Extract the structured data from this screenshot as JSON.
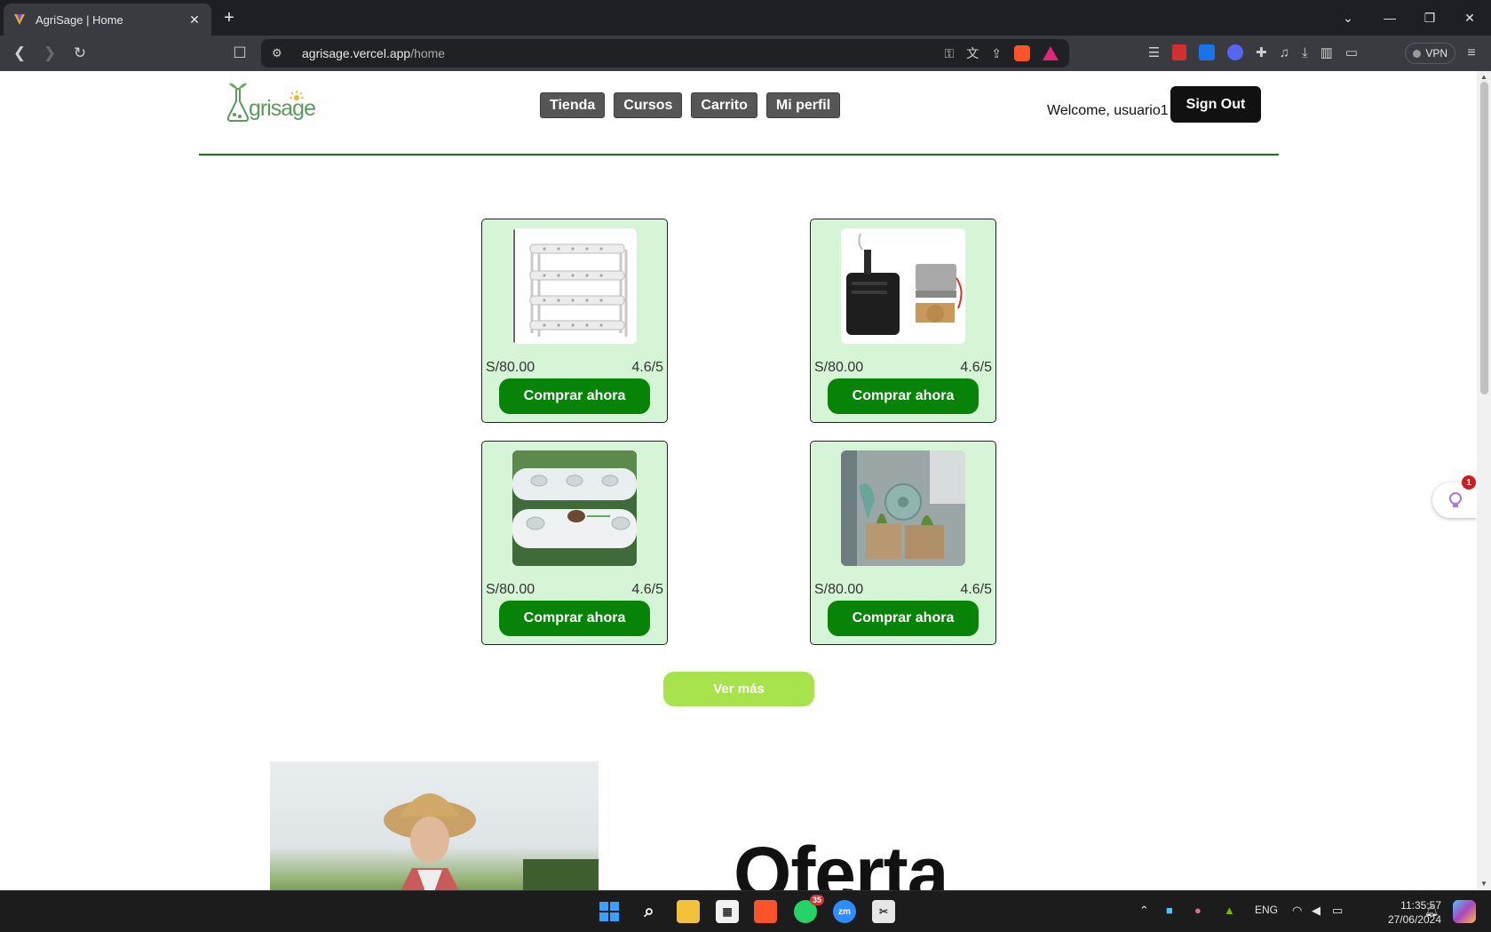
{
  "browser": {
    "tab_title": "AgriSage | Home",
    "close_tab": "✕",
    "new_tab": "+",
    "url_host": "agrisage.vercel.app",
    "url_path": "/home",
    "vpn_label": "VPN"
  },
  "site": {
    "logo_text": "grisage",
    "nav": [
      "Tienda",
      "Cursos",
      "Carrito",
      "Mi perfil"
    ],
    "welcome": "Welcome, usuario1",
    "sign_out": "Sign Out"
  },
  "products": [
    {
      "price": "S/80.00",
      "rating": "4.6/5",
      "button": "Comprar ahora",
      "image": "shelf-rack-image"
    },
    {
      "price": "S/80.00",
      "rating": "4.6/5",
      "button": "Comprar ahora",
      "image": "water-pump-image"
    },
    {
      "price": "S/80.00",
      "rating": "4.6/5",
      "button": "Comprar ahora",
      "image": "pvc-pipes-image"
    },
    {
      "price": "S/80.00",
      "rating": "4.6/5",
      "button": "Comprar ahora",
      "image": "grow-tent-image"
    }
  ],
  "ver_mas": "Ver más",
  "hero": {
    "heading": "Oferta"
  },
  "assistant_badge": "1",
  "taskbar": {
    "whatsapp_badge": "35",
    "language": "ENG",
    "time": "11:35:57",
    "date": "27/06/2024"
  }
}
